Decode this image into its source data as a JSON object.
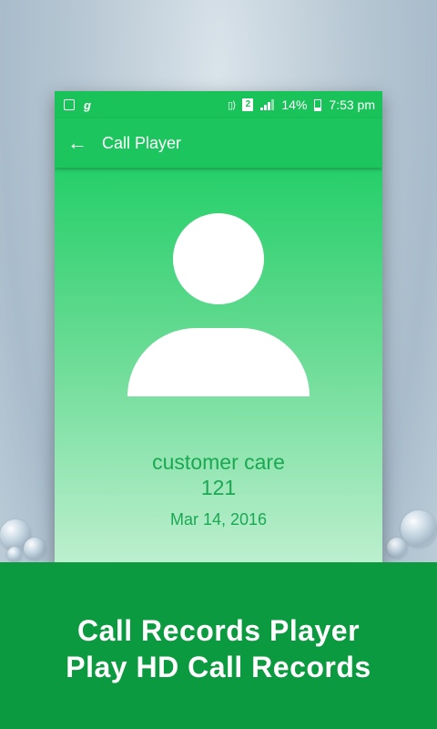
{
  "status_bar": {
    "battery": "14%",
    "time": "7:53 pm",
    "sim_label": "2"
  },
  "app_bar": {
    "title": "Call Player",
    "back_glyph": "←"
  },
  "contact": {
    "name": "customer care",
    "number": "121",
    "date": "Mar 14, 2016"
  },
  "banner": {
    "line1": "Call Records Player",
    "line2": "Play HD Call Records"
  },
  "colors": {
    "primary_green": "#1dc55e",
    "banner_green": "#0b9a3f",
    "text_green": "#1aa852"
  }
}
